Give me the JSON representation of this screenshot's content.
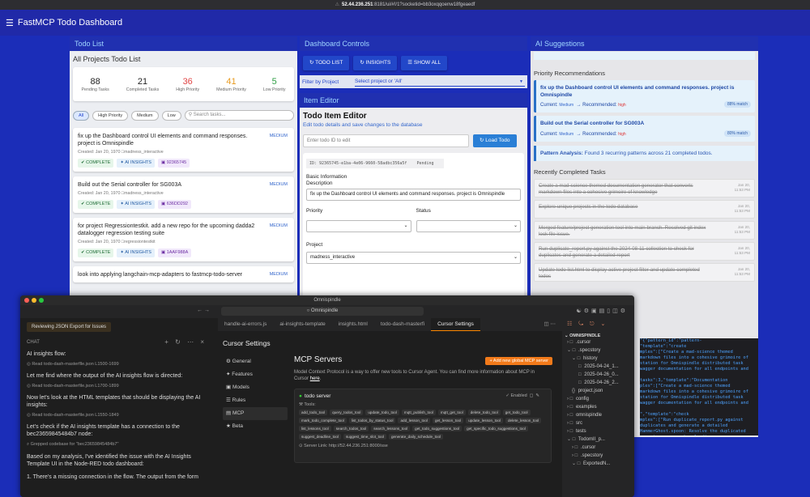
{
  "browser": {
    "url_host": "52.44.236.251",
    "url_rest": ":8181/ui/#!/1?socketid=bb3oxqqoenw18fgeaedf"
  },
  "app": {
    "title": "FastMCP Todo Dashboard"
  },
  "todo_panel": {
    "header": "Todo List",
    "title": "All Projects Todo List",
    "stats": [
      {
        "value": "88",
        "label": "Pending Tasks",
        "color": "#222222"
      },
      {
        "value": "21",
        "label": "Completed Tasks",
        "color": "#222222"
      },
      {
        "value": "36",
        "label": "High Priority",
        "color": "#e04545"
      },
      {
        "value": "41",
        "label": "Medium Priority",
        "color": "#e89a1e"
      },
      {
        "value": "5",
        "label": "Low Priority",
        "color": "#2f9e44"
      }
    ],
    "filters": [
      "All",
      "High Priority",
      "Medium",
      "Low"
    ],
    "search_placeholder": "Search tasks...",
    "cards": [
      {
        "text": "fix up the Dashboard control UI elements and command responses. project is Omnispindle",
        "priority": "MEDIUM",
        "meta": "Created: Jan 20, 1970 □madness_interactive",
        "complete": "✔ COMPLETE",
        "insights": "✦ AI INSIGHTS",
        "hash": "92365745"
      },
      {
        "text": "Build out the Serial controller for SG003A",
        "priority": "MEDIUM",
        "meta": "Created: Jan 20, 1970 □madness_interactive",
        "complete": "✔ COMPLETE",
        "insights": "✦ AI INSIGHTS",
        "hash": "636DD292"
      },
      {
        "text": "for project Regressiontestkit. add a new repo for the upcoming dadda2 datalogger regression testing suite",
        "priority": "MEDIUM",
        "meta": "Created: Jan 20, 1970 □regressiontestkit",
        "complete": "✔ COMPLETE",
        "insights": "✦ AI INSIGHTS",
        "hash": "1AAF988A"
      },
      {
        "text": "look into applying langchain-mcp-adapters to fastmcp-todo-server",
        "priority": "MEDIUM",
        "meta": "",
        "complete": "",
        "insights": "",
        "hash": ""
      }
    ]
  },
  "controls": {
    "header": "Dashboard Controls",
    "buttons": [
      "↻ TODO LIST",
      "↻ INSIGHTS",
      "☰ SHOW ALL"
    ],
    "filter_label": "Filter by Project",
    "filter_placeholder": "Select project or 'All'",
    "editor_header": "Item Editor",
    "editor_title": "Todo Item Editor",
    "editor_sub": "Edit todo details and save changes to the database",
    "id_placeholder": "Enter todo ID to edit",
    "load_btn": "↻ Load Todo",
    "id_box": "ID: 92365745-e1ba-4e06-9660-58adbc356a5f    Pending",
    "basic_info": "Basic Information",
    "description_label": "Description",
    "description_value": "fix up the Dashboard control UI elements and command responses. project is Omnispindle",
    "priority_label": "Priority",
    "status_label": "Status",
    "project_label": "Project",
    "project_value": "madness_interactive"
  },
  "ai": {
    "header": "AI Suggestions",
    "priority_title": "Priority Recommendations",
    "recs": [
      {
        "title": "fix up the Dashboard control UI elements and command responses. project is Omnispindle",
        "current_label": "Current:",
        "current": "Medium",
        "arrow": "→ Recommended:",
        "rec": "high",
        "pct": "88% match"
      },
      {
        "title": "Build out the Serial controller for SG003A",
        "current_label": "Current:",
        "current": "Medium",
        "arrow": "→ Recommended:",
        "rec": "high",
        "pct": "80% match"
      }
    ],
    "pattern_bold": "Pattern Analysis:",
    "pattern_text": " Found 3 recurring patterns across 21 completed todos.",
    "completed_title": "Recently Completed Tasks",
    "completed": [
      {
        "text": "Create a mad-science themed documentation generator that converts markdown files into a cohesive grimoire of knowledge",
        "date": "Jan 20,",
        "time": "11:53 PM"
      },
      {
        "text": "Explore unique projects in the todo database",
        "date": "Jan 20,",
        "time": "11:53 PM"
      },
      {
        "text": "Merged feature/project generation tool into main branch. Resolved git index lock file issue.",
        "date": "Jan 20,",
        "time": "11:53 PM"
      },
      {
        "text": "Run duplicate_report.py against the 2024-08-11 collection to check for duplicates and generate a detailed report",
        "date": "Jan 20,",
        "time": "11:53 PM"
      },
      {
        "text": "Update todo list.html to display active project filter and update completed todos",
        "date": "Jan 20,",
        "time": "11:53 PM"
      }
    ]
  },
  "code_snippet": "\"{\"pattern_id\":\"pattern-\n\"template\":\"create\nmples\":[\"Create a mad-science themed\nmarkdown files into a cohesive grimoire of\nstation for Omnispindle distributed task\nwagger documentation for all endpoints and\n\ntasks\":3,\"template\":\"Documentation\nples\":[\"Create a mad-science themed\nmarkdown files into a cohesive grimoire of\nstation for Omnispindle distributed task\nwagger documentation for all endpoints and\n\n\",\"template\":\"check\nmples\":[\"Run duplicate_report.py against\nduplicates and generate a detailed\nHammerGhost.spoon: Resolve the duplicated\n causing errors when loading",
  "cursor": {
    "window_title": "Omnispindle",
    "search_box": "○ Omnispindle",
    "chat_tab": "Reviewing JSON Export for Issues",
    "chat_label": "CHAT",
    "messages": [
      {
        "type": "p",
        "text": "AI insights flow:"
      },
      {
        "type": "read",
        "text": "◎ Read todo-dash-masterflle.json L1500-1699"
      },
      {
        "type": "p",
        "text": "Let me find where the output of the AI insights flow is directed:"
      },
      {
        "type": "read",
        "text": "◎ Read todo-dash-masterfile.json L1700-1899"
      },
      {
        "type": "p",
        "text": "Now let's look at the HTML templates that should be displaying the AI insights:"
      },
      {
        "type": "read",
        "text": "◎ Read todo-dash-masterfile.json L1550-1849"
      },
      {
        "type": "p",
        "text": "Let's check if the AI insights template has a connection to the bec23659845484b7 node:"
      },
      {
        "type": "read",
        "text": "⌕ Grepped codebase for \"bec23659845484b7\""
      },
      {
        "type": "p",
        "text": "Based on my analysis, I've identified the issue with the AI Insights Template UI in the Node-RED todo dashboard:"
      },
      {
        "type": "p",
        "text": "1. There's a missing connection in the flow. The output from the form"
      }
    ],
    "tabs": [
      "handle-ai-errors.js",
      "ai-insights-template",
      "insights.html",
      "todo-dash-masterfi",
      "Cursor Settings"
    ],
    "settings_title": "Cursor Settings",
    "nav": [
      "⚙ General",
      "✦ Features",
      "▣ Models",
      "☰ Rules",
      "▤ MCP",
      "★ Beta"
    ],
    "mcp_title": "MCP Servers",
    "add_btn": "+ Add new global MCP server",
    "mcp_desc": "Model Context Protocol is a way to offer new tools to Cursor Agent. You can find more information about MCP in Cursor ",
    "mcp_link": "here",
    "server_name": "todo server",
    "server_enabled": "✓ Enabled",
    "tools_label": "⚒ Tools:",
    "tools": [
      "add_todo_tool",
      "query_todos_tool",
      "update_todo_tool",
      "mqtt_publish_tool",
      "mqtt_get_tool",
      "delete_todo_tool",
      "get_todo_tool",
      "mark_todo_complete_tool",
      "list_todos_by_status_tool",
      "add_lesson_tool",
      "get_lesson_tool",
      "update_lesson_tool",
      "delete_lesson_tool",
      "list_lessons_tool",
      "search_todos_tool",
      "search_lessons_tool",
      "get_todo_suggestions_tool",
      "get_specific_todo_suggestions_tool",
      "suggest_deadline_tool",
      "suggest_time_slot_tool",
      "generate_daily_schedule_tool"
    ],
    "server_link": "⊙ Server Link: http://52.44.236.251:8000/sse",
    "explorer_root": "OMNISPINDLE",
    "tree": [
      {
        "indent": 6,
        "icon": "› □",
        "label": ".cursor"
      },
      {
        "indent": 6,
        "icon": "⌄ □",
        "label": ".specstory"
      },
      {
        "indent": 12,
        "icon": "⌄ □",
        "label": "history"
      },
      {
        "indent": 20,
        "icon": "□",
        "label": "2025-04-24_1..."
      },
      {
        "indent": 20,
        "icon": "□",
        "label": "2025-04-26_0..."
      },
      {
        "indent": 20,
        "icon": "□",
        "label": "2025-04-26_2..."
      },
      {
        "indent": 12,
        "icon": "{}",
        "label": "project.json"
      },
      {
        "indent": 6,
        "icon": "› □",
        "label": "config"
      },
      {
        "indent": 6,
        "icon": "› □",
        "label": "examples"
      },
      {
        "indent": 6,
        "icon": "› □",
        "label": "omnispindle"
      },
      {
        "indent": 6,
        "icon": "› □",
        "label": "src"
      },
      {
        "indent": 6,
        "icon": "› □",
        "label": "tests"
      },
      {
        "indent": 6,
        "icon": "⌄ □",
        "label": "TodomII_p..."
      },
      {
        "indent": 12,
        "icon": "› □",
        "label": ".cursor"
      },
      {
        "indent": 12,
        "icon": "› □",
        "label": ".specstory"
      },
      {
        "indent": 12,
        "icon": "⌄ □",
        "label": "ExportedN..."
      }
    ]
  }
}
